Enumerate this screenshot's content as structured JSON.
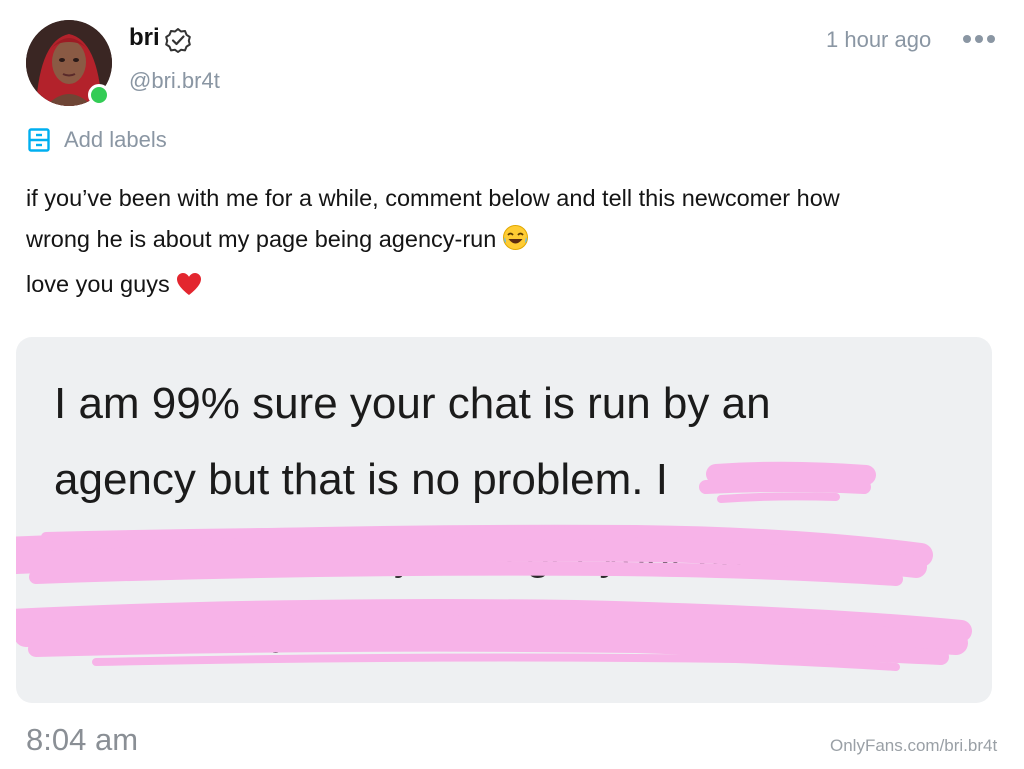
{
  "post": {
    "author": {
      "name": "bri",
      "handle": "@bri.br4t",
      "verified_icon": "verified-badge-icon",
      "online_status_color": "#33cc55"
    },
    "time_ago": "1 hour ago",
    "more_icon": "ellipsis-icon",
    "labels": {
      "icon": "label-icon",
      "text": "Add labels"
    },
    "caption": {
      "line1": "if you’ve been with me for a while, comment below and tell this newcomer how",
      "line2": "wrong he is about my page being agency-run",
      "line2_emoji": "😂",
      "line3": "love you guys",
      "line3_emoji": "❤️"
    },
    "image": {
      "message_line1": "I am 99% sure your chat is run by an",
      "message_line2": "agency but that is no problem. I",
      "message_line3": "registered on OF just to get your count",
      "message_line4": "the past day with natural interaction",
      "redaction_color": "#f7b3e8",
      "time": "8:04 am",
      "watermark": "OnlyFans.com/bri.br4t"
    }
  },
  "colors": {
    "accent": "#00aff0",
    "muted_text": "#8a96a3",
    "card_background": "#eef0f2"
  }
}
